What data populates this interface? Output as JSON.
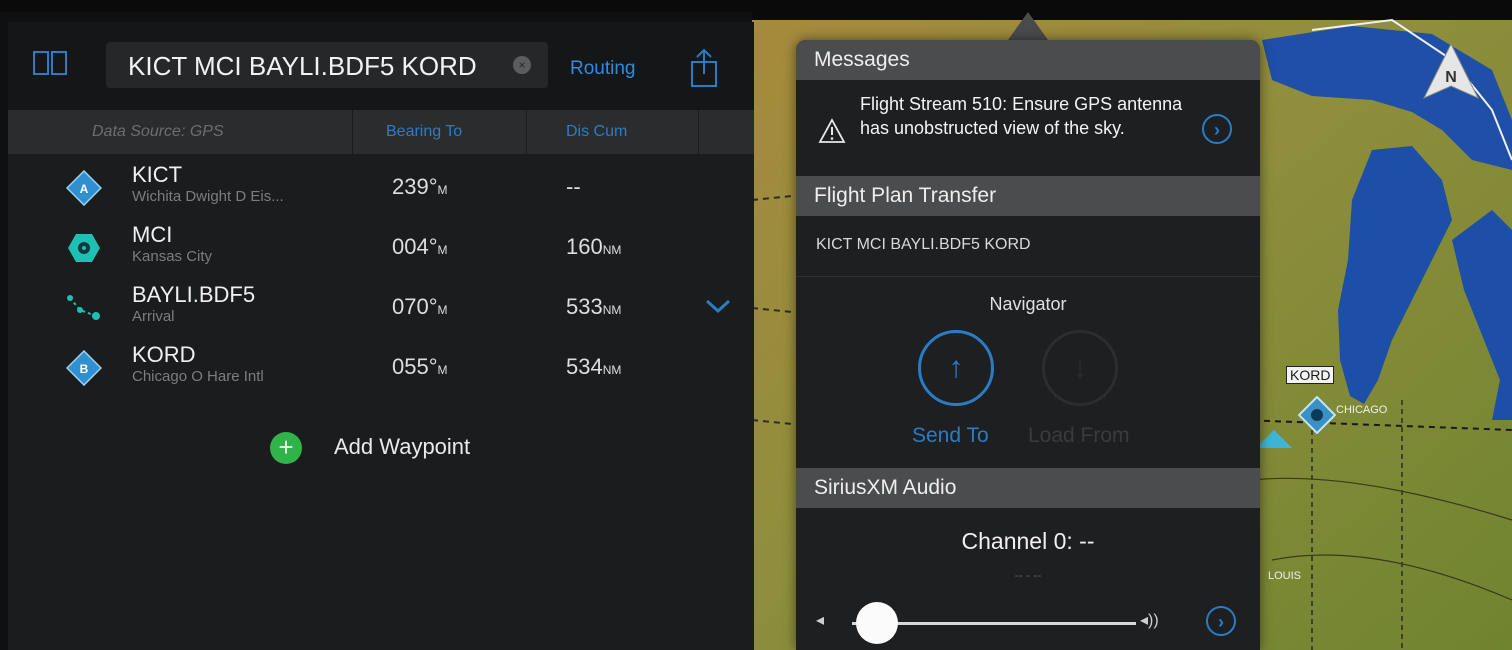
{
  "route": {
    "text": "KICT MCI BAYLI.BDF5 KORD",
    "clear": "×",
    "routing_label": "Routing"
  },
  "columns": {
    "source": "Data Source: GPS",
    "bearing": "Bearing To",
    "distance": "Dis Cum"
  },
  "waypoints": [
    {
      "name": "KICT",
      "sub": "Wichita Dwight D Eis...",
      "bearing": "239°",
      "bearing_unit": "M",
      "dist": "--",
      "dist_unit": "",
      "icon": "airport-diamond-icon",
      "badge": "A"
    },
    {
      "name": "MCI",
      "sub": "Kansas City",
      "bearing": "004°",
      "bearing_unit": "M",
      "dist": "160",
      "dist_unit": "NM",
      "icon": "vor-icon"
    },
    {
      "name": "BAYLI.BDF5",
      "sub": "Arrival",
      "bearing": "070°",
      "bearing_unit": "M",
      "dist": "533",
      "dist_unit": "NM",
      "icon": "procedure-arrival-icon"
    },
    {
      "name": "KORD",
      "sub": "Chicago O Hare Intl",
      "bearing": "055°",
      "bearing_unit": "M",
      "dist": "534",
      "dist_unit": "NM",
      "icon": "airport-diamond-icon",
      "badge": "B"
    }
  ],
  "add_waypoint": {
    "plus": "+",
    "label": "Add Waypoint"
  },
  "popover": {
    "messages_title": "Messages",
    "message_text": "Flight Stream 510: Ensure GPS antenna has unobstructed view of the sky.",
    "message_action": "›",
    "fpt_title": "Flight Plan Transfer",
    "fpt_plan": "KICT MCI BAYLI.BDF5 KORD",
    "navigator_title": "Navigator",
    "send_glyph": "↑",
    "load_glyph": "↓",
    "send_label": "Send To",
    "load_label": "Load From",
    "audio_title": "SiriusXM Audio",
    "channel": "Channel 0: --",
    "channel_sub": "-- - --",
    "audio_action": "›",
    "vol_low": "◂",
    "vol_high": "◂))",
    "volume_level": 0.05
  },
  "map": {
    "north": "N",
    "kord": "KORD",
    "chicago": "CHICAGO",
    "louis": "LOUIS"
  },
  "colors": {
    "accent": "#2a7cc7",
    "add_green": "#2fb34a",
    "panel_bg": "#1b1c1e",
    "lake": "#1f4fa6",
    "land": "#8f8e3c"
  }
}
